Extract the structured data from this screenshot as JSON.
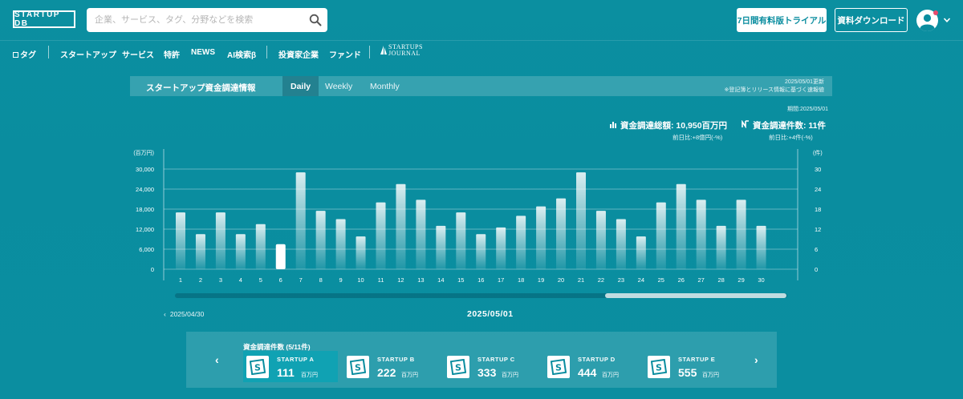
{
  "header": {
    "logo": "STARTUP DB",
    "search_placeholder": "企業、サービス、タグ、分野などを検索",
    "trial_button": "7日間有料版トライアル",
    "download_button": "資料ダウンロード"
  },
  "nav": {
    "items": [
      "タグ",
      "スタートアップ",
      "サービス",
      "特許",
      "NEWS",
      "AI検索β",
      "投資家企業",
      "ファンド"
    ],
    "journal_line1": "STARTUPS",
    "journal_line2": "JOURNAL"
  },
  "panel": {
    "title": "スタートアップ資金調達情報",
    "tabs": [
      "Daily",
      "Weekly",
      "Monthly"
    ],
    "active_tab": "Daily",
    "updated": "2025/05/01更新",
    "note": "※登記簿とリリース情報に基づく速報値",
    "period": "期間:2025/05/01",
    "total_amount": "資金調達総額: 10,950百万円",
    "total_amount_sub": "前日比:+8億円(-%)",
    "total_count": "資金調達件数: 11件",
    "total_count_sub": "前日比:+4件(-%)"
  },
  "chart_data": {
    "type": "bar",
    "categories": [
      "1",
      "2",
      "3",
      "4",
      "5",
      "6",
      "7",
      "8",
      "9",
      "10",
      "11",
      "12",
      "13",
      "14",
      "15",
      "16",
      "17",
      "18",
      "19",
      "20",
      "21",
      "22",
      "23",
      "24",
      "25",
      "26",
      "27",
      "28",
      "29",
      "30"
    ],
    "values": [
      17000,
      10500,
      17000,
      10500,
      13500,
      7500,
      29000,
      17500,
      15000,
      9800,
      20000,
      25500,
      20800,
      13000,
      17000,
      10500,
      12500,
      16000,
      18800,
      21200,
      29000,
      17500,
      15000,
      9800,
      20000,
      25500,
      20800,
      13000,
      20800,
      13000
    ],
    "highlight_index": 5,
    "left_unit": "(百万円)",
    "right_unit": "(件)",
    "ylim": [
      0,
      30000
    ],
    "yticks": [
      "0",
      "6,000",
      "12,000",
      "18,000",
      "24,000",
      "30,000"
    ],
    "y2ticks": [
      "0",
      "6",
      "12",
      "18",
      "24",
      "30"
    ],
    "grid": true
  },
  "dates": {
    "prev": "2025/04/30",
    "current": "2025/05/01"
  },
  "cards": {
    "label": "資金調達件数 (5/11件)",
    "unit": "百万円",
    "items": [
      {
        "name": "STARTUP A",
        "amount": "111"
      },
      {
        "name": "STARTUP B",
        "amount": "222"
      },
      {
        "name": "STARTUP C",
        "amount": "333"
      },
      {
        "name": "STARTUP D",
        "amount": "444"
      },
      {
        "name": "STARTUP E",
        "amount": "555"
      }
    ],
    "active_index": 0
  }
}
